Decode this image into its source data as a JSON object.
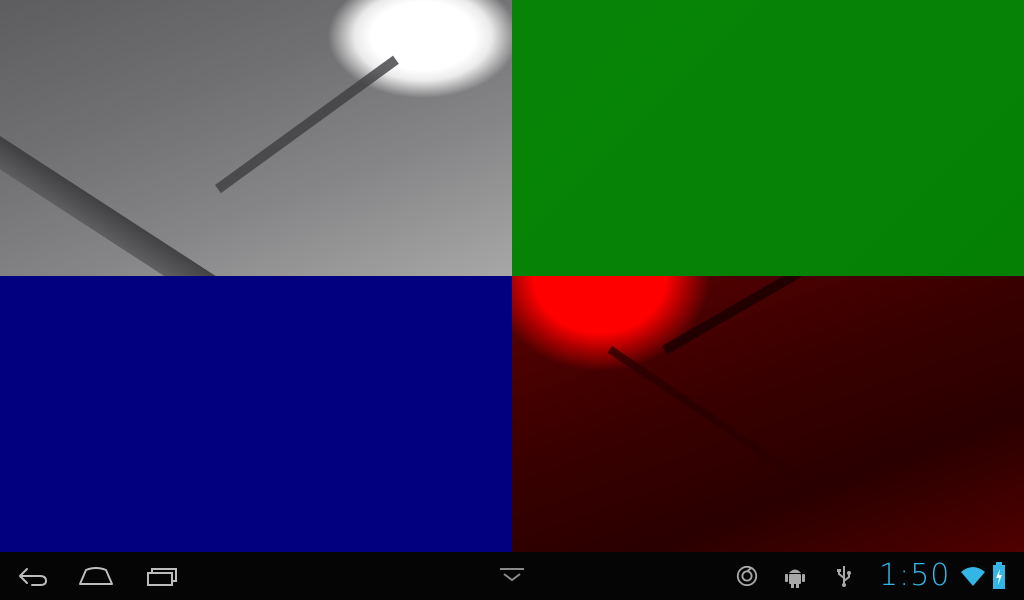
{
  "quadrants": [
    {
      "name": "original",
      "tint": "#808080"
    },
    {
      "name": "green-channel",
      "tint": "#068306"
    },
    {
      "name": "blue-channel",
      "tint": "#03007f"
    },
    {
      "name": "red-channel",
      "tint": "#ff0000"
    }
  ],
  "system_bar": {
    "clock": "1:50",
    "accent_color": "#33b5e5",
    "nav_buttons": [
      "back-icon",
      "home-icon",
      "recent-apps-icon"
    ],
    "hide_button": "chevron-down-icon",
    "notification_icons": [
      "sync-icon",
      "android-debug-icon",
      "usb-icon"
    ],
    "status_icons": [
      "wifi-icon",
      "battery-charging-icon"
    ]
  }
}
